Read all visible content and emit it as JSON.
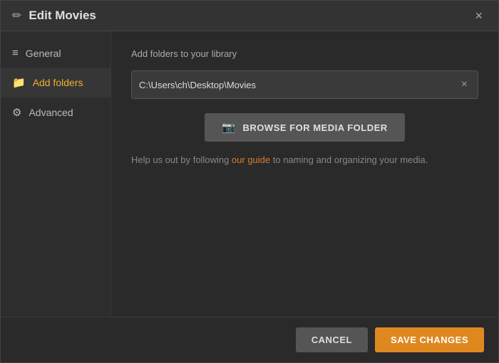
{
  "dialog": {
    "title": "Edit Movies",
    "close_label": "×",
    "title_icon": "✏"
  },
  "sidebar": {
    "items": [
      {
        "id": "general",
        "label": "General",
        "icon": "≡",
        "active": false
      },
      {
        "id": "add-folders",
        "label": "Add folders",
        "icon": "📁",
        "active": true
      },
      {
        "id": "advanced",
        "label": "Advanced",
        "icon": "⚙",
        "active": false
      }
    ]
  },
  "main": {
    "section_label": "Add folders to your library",
    "folder_path": "C:\\Users\\ch\\Desktop\\Movies",
    "folder_clear_label": "×",
    "browse_button_label": "BROWSE FOR MEDIA FOLDER",
    "browse_icon": "📷",
    "guide_text_before": "Help us out by following ",
    "guide_link_text": "our guide",
    "guide_text_after": " to naming and organizing your media."
  },
  "footer": {
    "cancel_label": "CANCEL",
    "save_label": "SAVE CHANGES"
  },
  "colors": {
    "accent": "#e08820",
    "link": "#d87d2e"
  }
}
